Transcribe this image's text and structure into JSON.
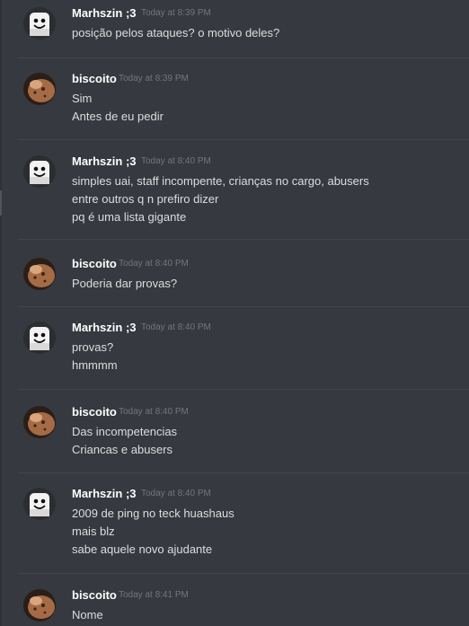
{
  "messages": [
    {
      "avatar": "marshmello-avatar",
      "author": "Marhszin ;3",
      "timestamp": "Today at 8:39 PM",
      "lines": [
        "posição pelos ataques? o motivo deles?"
      ]
    },
    {
      "avatar": "cookie-avatar",
      "author": "biscoito",
      "timestamp": "Today at 8:39 PM",
      "lines": [
        "Sim",
        "Antes de eu pedir"
      ]
    },
    {
      "avatar": "marshmello-avatar",
      "author": "Marhszin ;3",
      "timestamp": "Today at 8:40 PM",
      "lines": [
        "simples uai, staff incompente, crianças no cargo, abusers",
        "entre outros q n prefiro dizer",
        "pq é uma lista gigante"
      ]
    },
    {
      "avatar": "cookie-avatar",
      "author": "biscoito",
      "timestamp": "Today at 8:40 PM",
      "lines": [
        "Poderia dar provas?"
      ]
    },
    {
      "avatar": "marshmello-avatar",
      "author": "Marhszin ;3",
      "timestamp": "Today at 8:40 PM",
      "lines": [
        "provas?",
        "hmmmm"
      ]
    },
    {
      "avatar": "cookie-avatar",
      "author": "biscoito",
      "timestamp": "Today at 8:40 PM",
      "lines": [
        "Das incompetencias",
        "Criancas e abusers"
      ]
    },
    {
      "avatar": "marshmello-avatar",
      "author": "Marhszin ;3",
      "timestamp": "Today at 8:40 PM",
      "lines": [
        "2009 de ping no teck huashaus",
        "mais blz",
        "sabe aquele novo ajudante"
      ]
    },
    {
      "avatar": "cookie-avatar",
      "author": "biscoito",
      "timestamp": "Today at 8:41 PM",
      "lines": [
        "Nome"
      ]
    }
  ]
}
